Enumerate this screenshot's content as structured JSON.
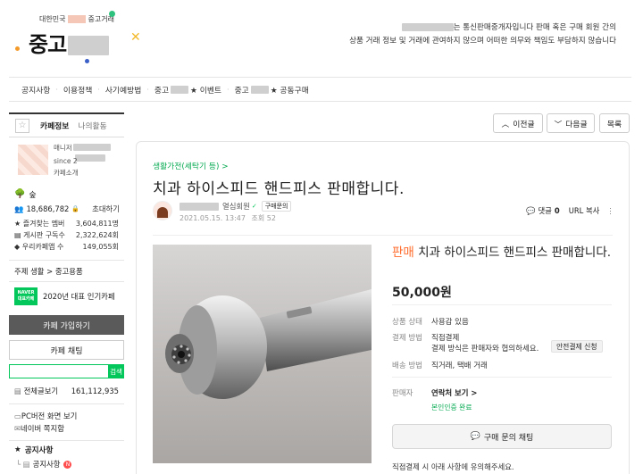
{
  "header": {
    "brand_small": "대한민국",
    "brand_small_suffix": "중고거래",
    "brand_big": "중고",
    "notice_line1_suffix": "는 통신판매중개자입니다 판매 혹은 구매 회원 간의",
    "notice_line2": "상품 거래 정보 및 거래에 관여하지 않으며 어떠한 의무와 책임도 부담하지 않습니다"
  },
  "nav": {
    "items": [
      {
        "label": "공지사항"
      },
      {
        "label": "이용정책"
      },
      {
        "label": "사기예방법"
      },
      {
        "label": "중고",
        "suffix": "★ 이벤트"
      },
      {
        "label": "중고",
        "suffix": "★ 공동구매"
      }
    ]
  },
  "sidebar": {
    "tab_info": "카페정보",
    "tab_activity": "나의활동",
    "manager_label": "매니저",
    "since": "since 2",
    "cafe_intro": "카페소개",
    "level": "숲",
    "members": "18,686,782",
    "invite": "초대하기",
    "stats": [
      {
        "label": "즐겨찾는 멤버",
        "value": "3,604,811명"
      },
      {
        "label": "게시판 구독수",
        "value": "2,322,624회"
      },
      {
        "label": "우리카페앱 수",
        "value": "149,055회"
      }
    ],
    "topic": "주제 생활 > 중고용품",
    "badge_line1": "NAVER",
    "badge_line2": "대표카페",
    "badge_text": "2020년 대표 인기카페",
    "join_button": "카페 가입하기",
    "chat_button": "카페 채팅",
    "search_button": "검색",
    "all_posts_label": "전체글보기",
    "all_posts_count": "161,112,935",
    "pc_view": "PC버전 화면 보기",
    "naver_memo": "네이버 쪽지함",
    "notice_header": "공지사항",
    "notice_item": "공지사항",
    "new_badge": "N"
  },
  "top_buttons": {
    "prev": "이전글",
    "next": "다음글",
    "list": "목록"
  },
  "article": {
    "category": "생활가전(세탁기 등) >",
    "title": "치과 하이스피드 핸드피스 판매합니다.",
    "member_grade": "열심회원",
    "buyer_inquiry": "구매문의",
    "date": "2021.05.15. 13:47",
    "views": "조회 52",
    "comments_label": "댓글",
    "comments_count": "0",
    "url_copy": "URL 복사",
    "sale_tag": "판매",
    "product_title": "치과 하이스피드 핸드피스 판매합니다.",
    "price": "50,000원",
    "details": [
      {
        "label": "상품 상태",
        "value": "사용감 있음"
      },
      {
        "label": "결제 방법",
        "value": "직접결제",
        "value2": "결제 방식은 판매자와 협의하세요.",
        "pill": "안전결제 신청"
      },
      {
        "label": "배송 방법",
        "value": "직거래, 택배 거래"
      },
      {
        "label": "판매자",
        "value": "연락처 보기 >",
        "value2": "본인인증 완료"
      }
    ],
    "chat_button": "구매 문의 채팅",
    "footer_note": "직접결제 시 아래 사항에 유의해주세요."
  },
  "colors": {
    "green": "#03c75a",
    "sale_orange": "#ff6a2a",
    "join_bg": "#5a5a5a"
  }
}
